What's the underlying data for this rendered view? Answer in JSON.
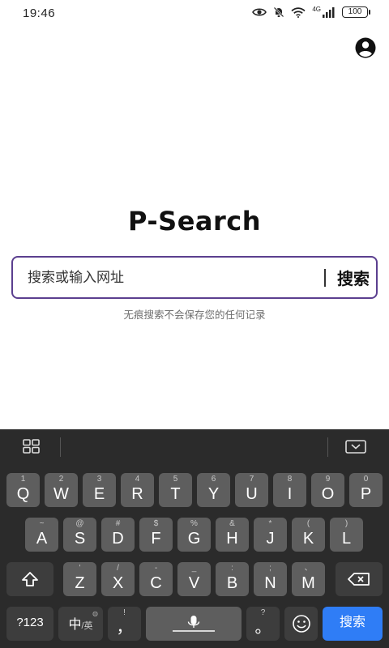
{
  "status": {
    "time": "19:46",
    "network": "4G",
    "battery": "100"
  },
  "app": {
    "title": "P-Search"
  },
  "search": {
    "placeholder": "搜索或输入网址",
    "button_label": "搜索",
    "hint": "无痕搜索不会保存您的任何记录"
  },
  "keyboard": {
    "row1": [
      {
        "main": "Q",
        "sub": "1"
      },
      {
        "main": "W",
        "sub": "2"
      },
      {
        "main": "E",
        "sub": "3"
      },
      {
        "main": "R",
        "sub": "4"
      },
      {
        "main": "T",
        "sub": "5"
      },
      {
        "main": "Y",
        "sub": "6"
      },
      {
        "main": "U",
        "sub": "7"
      },
      {
        "main": "I",
        "sub": "8"
      },
      {
        "main": "O",
        "sub": "9"
      },
      {
        "main": "P",
        "sub": "0"
      }
    ],
    "row2": [
      {
        "main": "A",
        "sub": "~"
      },
      {
        "main": "S",
        "sub": "@"
      },
      {
        "main": "D",
        "sub": "#"
      },
      {
        "main": "F",
        "sub": "$"
      },
      {
        "main": "G",
        "sub": "%"
      },
      {
        "main": "H",
        "sub": "&"
      },
      {
        "main": "J",
        "sub": "*"
      },
      {
        "main": "K",
        "sub": "("
      },
      {
        "main": "L",
        "sub": ")"
      }
    ],
    "row3": [
      {
        "main": "Z",
        "sub": "'"
      },
      {
        "main": "X",
        "sub": "/"
      },
      {
        "main": "C",
        "sub": "-"
      },
      {
        "main": "V",
        "sub": "_"
      },
      {
        "main": "B",
        "sub": ":"
      },
      {
        "main": "N",
        "sub": ";"
      },
      {
        "main": "M",
        "sub": "、"
      }
    ],
    "num_label": "?123",
    "lang_main": "中",
    "lang_sub": "/英",
    "comma": "，",
    "comma_sub": "!",
    "period": "。",
    "period_sub": "?",
    "enter_label": "搜索"
  },
  "icons": {
    "avatar": "account-circle-icon",
    "eye": "eye-icon",
    "mute": "bell-off-icon",
    "wifi": "wifi-icon",
    "signal": "signal-icon",
    "grid": "grid-icon",
    "hide_keyboard": "keyboard-hide-icon",
    "shift": "shift-icon",
    "backspace": "backspace-icon",
    "mic": "mic-icon",
    "emoji": "emoji-icon"
  },
  "colors": {
    "search_border": "#5b3f8f",
    "keyboard_bg": "#2b2b2b",
    "key_bg": "#5e5e5e",
    "key_dark_bg": "#3d3d3d",
    "enter_bg": "#2f7df6"
  }
}
